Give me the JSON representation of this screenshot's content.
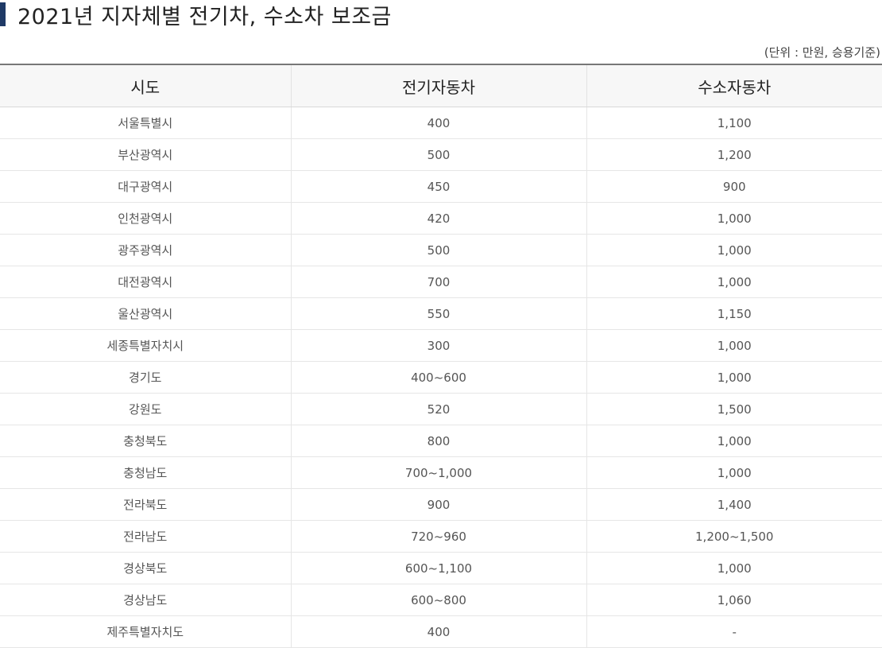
{
  "page": {
    "title": "2021년 지자체별 전기차, 수소차 보조금",
    "unit_note": "(단위 : 만원, 승용기준)",
    "accent_color": "#1f3a66"
  },
  "table": {
    "headers": [
      "시도",
      "전기자동차",
      "수소자동차"
    ],
    "rows": [
      [
        "서울특별시",
        "400",
        "1,100"
      ],
      [
        "부산광역시",
        "500",
        "1,200"
      ],
      [
        "대구광역시",
        "450",
        "900"
      ],
      [
        "인천광역시",
        "420",
        "1,000"
      ],
      [
        "광주광역시",
        "500",
        "1,000"
      ],
      [
        "대전광역시",
        "700",
        "1,000"
      ],
      [
        "울산광역시",
        "550",
        "1,150"
      ],
      [
        "세종특별자치시",
        "300",
        "1,000"
      ],
      [
        "경기도",
        "400~600",
        "1,000"
      ],
      [
        "강원도",
        "520",
        "1,500"
      ],
      [
        "충청북도",
        "800",
        "1,000"
      ],
      [
        "충청남도",
        "700~1,000",
        "1,000"
      ],
      [
        "전라북도",
        "900",
        "1,400"
      ],
      [
        "전라남도",
        "720~960",
        "1,200~1,500"
      ],
      [
        "경상북도",
        "600~1,100",
        "1,000"
      ],
      [
        "경상남도",
        "600~800",
        "1,060"
      ],
      [
        "제주특별자치도",
        "400",
        "-"
      ]
    ]
  }
}
